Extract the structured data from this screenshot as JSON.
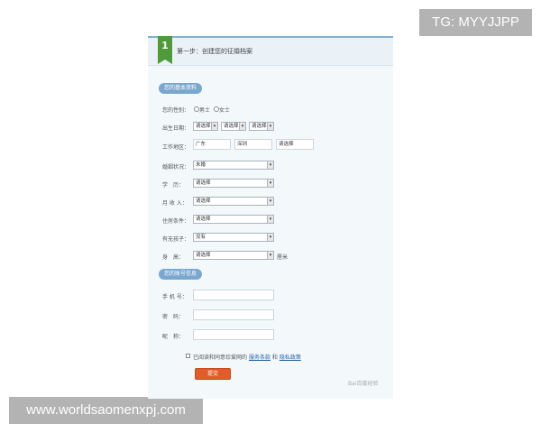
{
  "overlays": {
    "tg": "TG: MYYJJPP",
    "url": "www.worldsaomenxpj.com"
  },
  "card": {
    "step_number": "1",
    "title": "第一步：创建您的征婚档案",
    "section1": "您的基本资料",
    "gender": {
      "label": "您的性别：",
      "options": [
        "男士",
        "女士"
      ]
    },
    "birth": {
      "label": "出生日期：",
      "selects": [
        "请选择",
        "请选择",
        "请选择"
      ]
    },
    "work_area": {
      "label": "工作地区：",
      "values": [
        "广东",
        "深圳",
        "请选择"
      ]
    },
    "marital": {
      "label": "婚姻状况：",
      "value": "未婚"
    },
    "education": {
      "label": "学　历：",
      "value": "请选择"
    },
    "income": {
      "label": "月 收 入：",
      "value": "请选择"
    },
    "housing": {
      "label": "住房条件：",
      "value": "请选择"
    },
    "children": {
      "label": "有无孩子：",
      "value": "没有"
    },
    "height": {
      "label": "身　高：",
      "value": "请选择",
      "unit": "厘米"
    },
    "section2": "您的账号信息",
    "phone": {
      "label": "手 机 号：",
      "value": ""
    },
    "password": {
      "label": "密　码：",
      "value": ""
    },
    "nickname": {
      "label": "昵　称：",
      "value": ""
    },
    "agreement": {
      "text": "已阅读和同意珍爱网的",
      "link1": "服务条款",
      "and": "和",
      "link2": "隐私政策"
    },
    "submit": "提交",
    "watermark": "Bai百度经验"
  }
}
